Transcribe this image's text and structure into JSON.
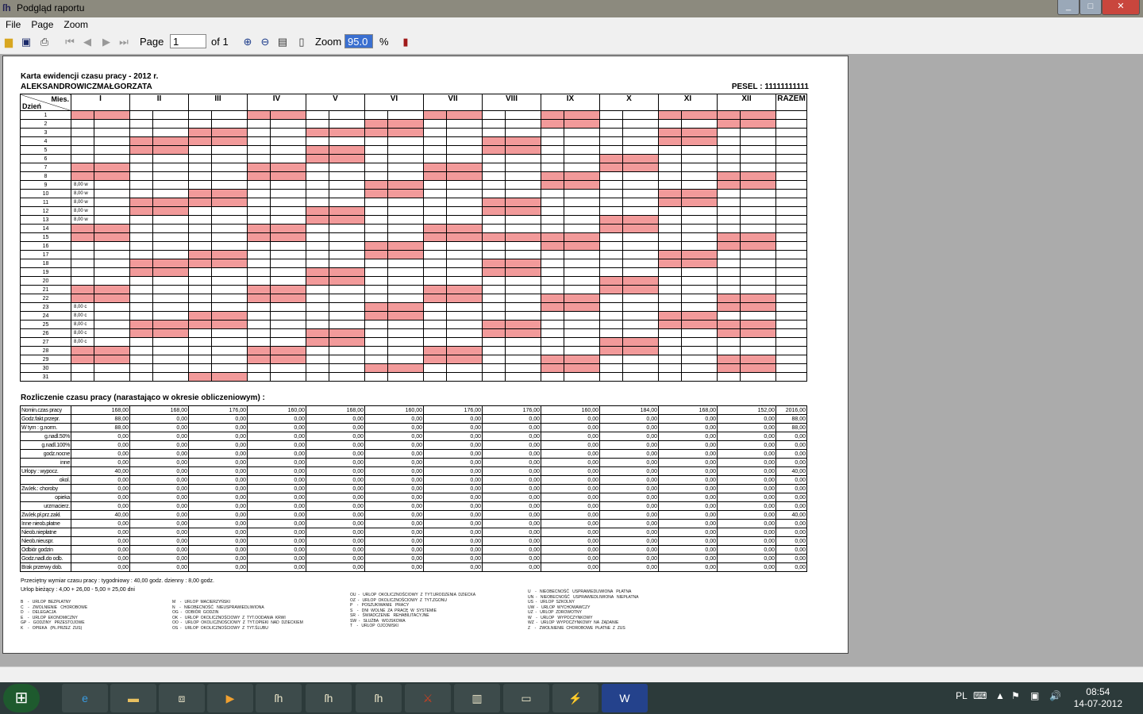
{
  "window": {
    "title": "Podgląd raportu",
    "app_icon": "report-app-icon"
  },
  "menu": [
    "File",
    "Page",
    "Zoom"
  ],
  "toolbar": {
    "page_label": "Page",
    "page_value": "1",
    "of_label": "of 1",
    "zoom_label": "Zoom",
    "zoom_value": "95.0",
    "percent": "%"
  },
  "report": {
    "title": "Karta ewidencji czasu pracy -   2012 r.",
    "name": "ALEKSANDROWICZMAŁGORZATA",
    "pesel": "PESEL  :   11111111111",
    "header_mies": "Mies.",
    "header_dzien": "Dzień",
    "months": [
      "I",
      "II",
      "III",
      "IV",
      "V",
      "VI",
      "VII",
      "VIII",
      "IX",
      "X",
      "XI",
      "XII"
    ],
    "total_header": "RAZEM",
    "highlight_color": "#f29a9a",
    "weekend_days": [
      [
        1,
        7,
        8,
        14,
        15,
        21,
        22,
        28,
        29
      ],
      [
        4,
        5,
        11,
        12,
        18,
        19,
        25,
        26
      ],
      [
        3,
        4,
        10,
        11,
        17,
        18,
        24,
        25,
        31
      ],
      [
        1,
        7,
        8,
        14,
        15,
        21,
        22,
        28,
        29
      ],
      [
        3,
        5,
        6,
        12,
        13,
        19,
        20,
        26,
        27
      ],
      [
        2,
        3,
        9,
        10,
        16,
        17,
        23,
        24,
        30
      ],
      [
        1,
        7,
        8,
        14,
        15,
        21,
        22,
        28,
        29
      ],
      [
        4,
        5,
        11,
        12,
        15,
        18,
        19,
        25,
        26
      ],
      [
        1,
        2,
        8,
        9,
        15,
        16,
        22,
        23,
        29,
        30
      ],
      [
        6,
        7,
        13,
        14,
        20,
        21,
        27,
        28
      ],
      [
        1,
        3,
        4,
        10,
        11,
        17,
        18,
        24,
        25
      ],
      [
        1,
        2,
        8,
        9,
        15,
        16,
        22,
        23,
        25,
        26,
        29,
        30
      ]
    ],
    "day_entries": {
      "9": "8,00 w",
      "10": "8,00 w",
      "11": "8,00 w",
      "12": "8,00 w",
      "13": "8,00 w",
      "23": "8,00 c",
      "24": "8,00 c",
      "25": "8,00 c",
      "26": "8,00 c",
      "27": "8,00 c"
    },
    "summary_title": "Rozliczenie czasu pracy (narastająco w okresie obliczeniowym)  :",
    "summary_rows": [
      {
        "label": "Nomin.czas pracy",
        "indent": false,
        "values": [
          "168,00",
          "168,00",
          "176,00",
          "160,00",
          "168,00",
          "160,00",
          "176,00",
          "176,00",
          "160,00",
          "184,00",
          "168,00",
          "152,00",
          "2016,00"
        ]
      },
      {
        "label": "Godz.fakt.przepr.",
        "indent": false,
        "values": [
          "88,00",
          "0,00",
          "0,00",
          "0,00",
          "0,00",
          "0,00",
          "0,00",
          "0,00",
          "0,00",
          "0,00",
          "0,00",
          "0,00",
          "88,00"
        ]
      },
      {
        "label": "W tym  :  g.norm.",
        "indent": false,
        "values": [
          "88,00",
          "0,00",
          "0,00",
          "0,00",
          "0,00",
          "0,00",
          "0,00",
          "0,00",
          "0,00",
          "0,00",
          "0,00",
          "0,00",
          "88,00"
        ]
      },
      {
        "label": "g.nadl.50%",
        "indent": true,
        "values": [
          "0,00",
          "0,00",
          "0,00",
          "0,00",
          "0,00",
          "0,00",
          "0,00",
          "0,00",
          "0,00",
          "0,00",
          "0,00",
          "0,00",
          "0,00"
        ]
      },
      {
        "label": "g.nadl.100%",
        "indent": true,
        "values": [
          "0,00",
          "0,00",
          "0,00",
          "0,00",
          "0,00",
          "0,00",
          "0,00",
          "0,00",
          "0,00",
          "0,00",
          "0,00",
          "0,00",
          "0,00"
        ]
      },
      {
        "label": "godz.nocne",
        "indent": true,
        "values": [
          "0,00",
          "0,00",
          "0,00",
          "0,00",
          "0,00",
          "0,00",
          "0,00",
          "0,00",
          "0,00",
          "0,00",
          "0,00",
          "0,00",
          "0,00"
        ]
      },
      {
        "label": "inne",
        "indent": true,
        "values": [
          "0,00",
          "0,00",
          "0,00",
          "0,00",
          "0,00",
          "0,00",
          "0,00",
          "0,00",
          "0,00",
          "0,00",
          "0,00",
          "0,00",
          "0,00"
        ]
      },
      {
        "label": "Urlopy : wypocz.",
        "indent": false,
        "values": [
          "40,00",
          "0,00",
          "0,00",
          "0,00",
          "0,00",
          "0,00",
          "0,00",
          "0,00",
          "0,00",
          "0,00",
          "0,00",
          "0,00",
          "40,00"
        ]
      },
      {
        "label": "okol.",
        "indent": true,
        "values": [
          "0,00",
          "0,00",
          "0,00",
          "0,00",
          "0,00",
          "0,00",
          "0,00",
          "0,00",
          "0,00",
          "0,00",
          "0,00",
          "0,00",
          "0,00"
        ]
      },
      {
        "label": "Zw.lek.: choroby",
        "indent": false,
        "values": [
          "0,00",
          "0,00",
          "0,00",
          "0,00",
          "0,00",
          "0,00",
          "0,00",
          "0,00",
          "0,00",
          "0,00",
          "0,00",
          "0,00",
          "0,00"
        ]
      },
      {
        "label": "opieka",
        "indent": true,
        "values": [
          "0,00",
          "0,00",
          "0,00",
          "0,00",
          "0,00",
          "0,00",
          "0,00",
          "0,00",
          "0,00",
          "0,00",
          "0,00",
          "0,00",
          "0,00"
        ]
      },
      {
        "label": "urzmacierz.",
        "indent": true,
        "values": [
          "0,00",
          "0,00",
          "0,00",
          "0,00",
          "0,00",
          "0,00",
          "0,00",
          "0,00",
          "0,00",
          "0,00",
          "0,00",
          "0,00",
          "0,00"
        ]
      },
      {
        "label": "Zw.lek.pł.prz.zakł.",
        "indent": false,
        "values": [
          "40,00",
          "0,00",
          "0,00",
          "0,00",
          "0,00",
          "0,00",
          "0,00",
          "0,00",
          "0,00",
          "0,00",
          "0,00",
          "0,00",
          "40,00"
        ]
      },
      {
        "label": "Inne nieob.płatne",
        "indent": false,
        "values": [
          "0,00",
          "0,00",
          "0,00",
          "0,00",
          "0,00",
          "0,00",
          "0,00",
          "0,00",
          "0,00",
          "0,00",
          "0,00",
          "0,00",
          "0,00"
        ]
      },
      {
        "label": "Nieob.niepłatne",
        "indent": false,
        "values": [
          "0,00",
          "0,00",
          "0,00",
          "0,00",
          "0,00",
          "0,00",
          "0,00",
          "0,00",
          "0,00",
          "0,00",
          "0,00",
          "0,00",
          "0,00"
        ]
      },
      {
        "label": "Nieob.nieuspr.",
        "indent": false,
        "values": [
          "0,00",
          "0,00",
          "0,00",
          "0,00",
          "0,00",
          "0,00",
          "0,00",
          "0,00",
          "0,00",
          "0,00",
          "0,00",
          "0,00",
          "0,00"
        ]
      },
      {
        "label": "Odbiór godzin",
        "indent": false,
        "values": [
          "0,00",
          "0,00",
          "0,00",
          "0,00",
          "0,00",
          "0,00",
          "0,00",
          "0,00",
          "0,00",
          "0,00",
          "0,00",
          "0,00",
          "0,00"
        ]
      },
      {
        "label": "Godz.nadl.do odb.",
        "indent": false,
        "values": [
          "0,00",
          "0,00",
          "0,00",
          "0,00",
          "0,00",
          "0,00",
          "0,00",
          "0,00",
          "0,00",
          "0,00",
          "0,00",
          "0,00",
          "0,00"
        ]
      },
      {
        "label": "Brak przerwy dob.",
        "indent": false,
        "values": [
          "0,00",
          "0,00",
          "0,00",
          "0,00",
          "0,00",
          "0,00",
          "0,00",
          "0,00",
          "0,00",
          "0,00",
          "0,00",
          "0,00",
          "0,00"
        ]
      }
    ],
    "norm_line": "Przeciętny wymiar czasu pracy  :        tygodniowy  :      40,00  godz.         dzienny  :      8,00  godz.",
    "leave_line": "Urlop bieżący  :        4,00  +    26,00  -      5,00  =      25,00  dni",
    "legend_cols": [
      "B    -   URLOP  BEZPŁATNY\nC    -   ZWOLNIENIE   CHOROBOWE\nD    -   DELEGACJA\nE    -   URLOP  EKONOMICZNY\nGP  -   GODZINY   PRZESTOJOWE\nK    -   OPIEKA   (PŁ.PRZEZ  ZUS)",
      "M    -   URLOP  MACIERZYŃSKI\nN    -   NIEOBECNOŚĆ   NIEUSPRAWIEDLIWIONA\nOG  -   ODBIÓR  GODZIN\nOK  -   URLOP  OKOLICZNOŚCIOWY  Z  TYT.OODANIA  KRWI\nOO  -   URLOP  OKOLICZNOŚCIOWY  Z  TYT.OPIEKI  NAD  DZIECKIEM\nOS  -   URLOP  OKOLICZNOŚCIOWY  Z  TYT.ŚLUBU",
      "OU  -   URLOP  OKOLICZNOŚCIOWY  Z  TYT.URODZENIA  DZIECKA\nOZ  -   URLOP  OKOLICZNOŚCIOWY  Z  TYT.ZGONU\nP    -   POSZUKIWANIE   PRACY\nS    -   DNI  WOLNE  ZA  PRACĘ  W  SYSTEMIE\nSR  -   ŚWIADCZENIE   REHABILITACYJNE\nSW  -   SŁUŻBA   WOJSKOWA\nT    -   URLOP  OJCOWSKI",
      "U    -   NIEOBECNOŚĆ   USPRAWIEDLIWIONA   PŁATNA\nUN  -   NIEOBECNOŚĆ   USPRAWIEDLIWIONA   NIEPŁATNA\nUS  -   URLOP  SZKOLNY\nUW  -   URLOP  WYCHOWAWCZY\nUZ  -   URLOP  ZDROWOTNY\nW    -   URLOP   WYPOCZYNKOWY\nWZ  -   URLOP  WYPOCZYNKOWY  NA  ŻĄDANIE\nZ    -   ZWOLNIENIE  CHOROBOWE  PŁATNE  Z  ZUS"
    ]
  },
  "taskbar": {
    "start": "start-orb",
    "apps": [
      "internet-explorer",
      "file-explorer",
      "dos-box",
      "media-player",
      "app-1",
      "app-2",
      "app-3",
      "spartan-app",
      "archive-app",
      "card-app",
      "tools-app",
      "word-app"
    ],
    "lang": "PL",
    "time": "08:54",
    "date": "14-07-2012"
  }
}
